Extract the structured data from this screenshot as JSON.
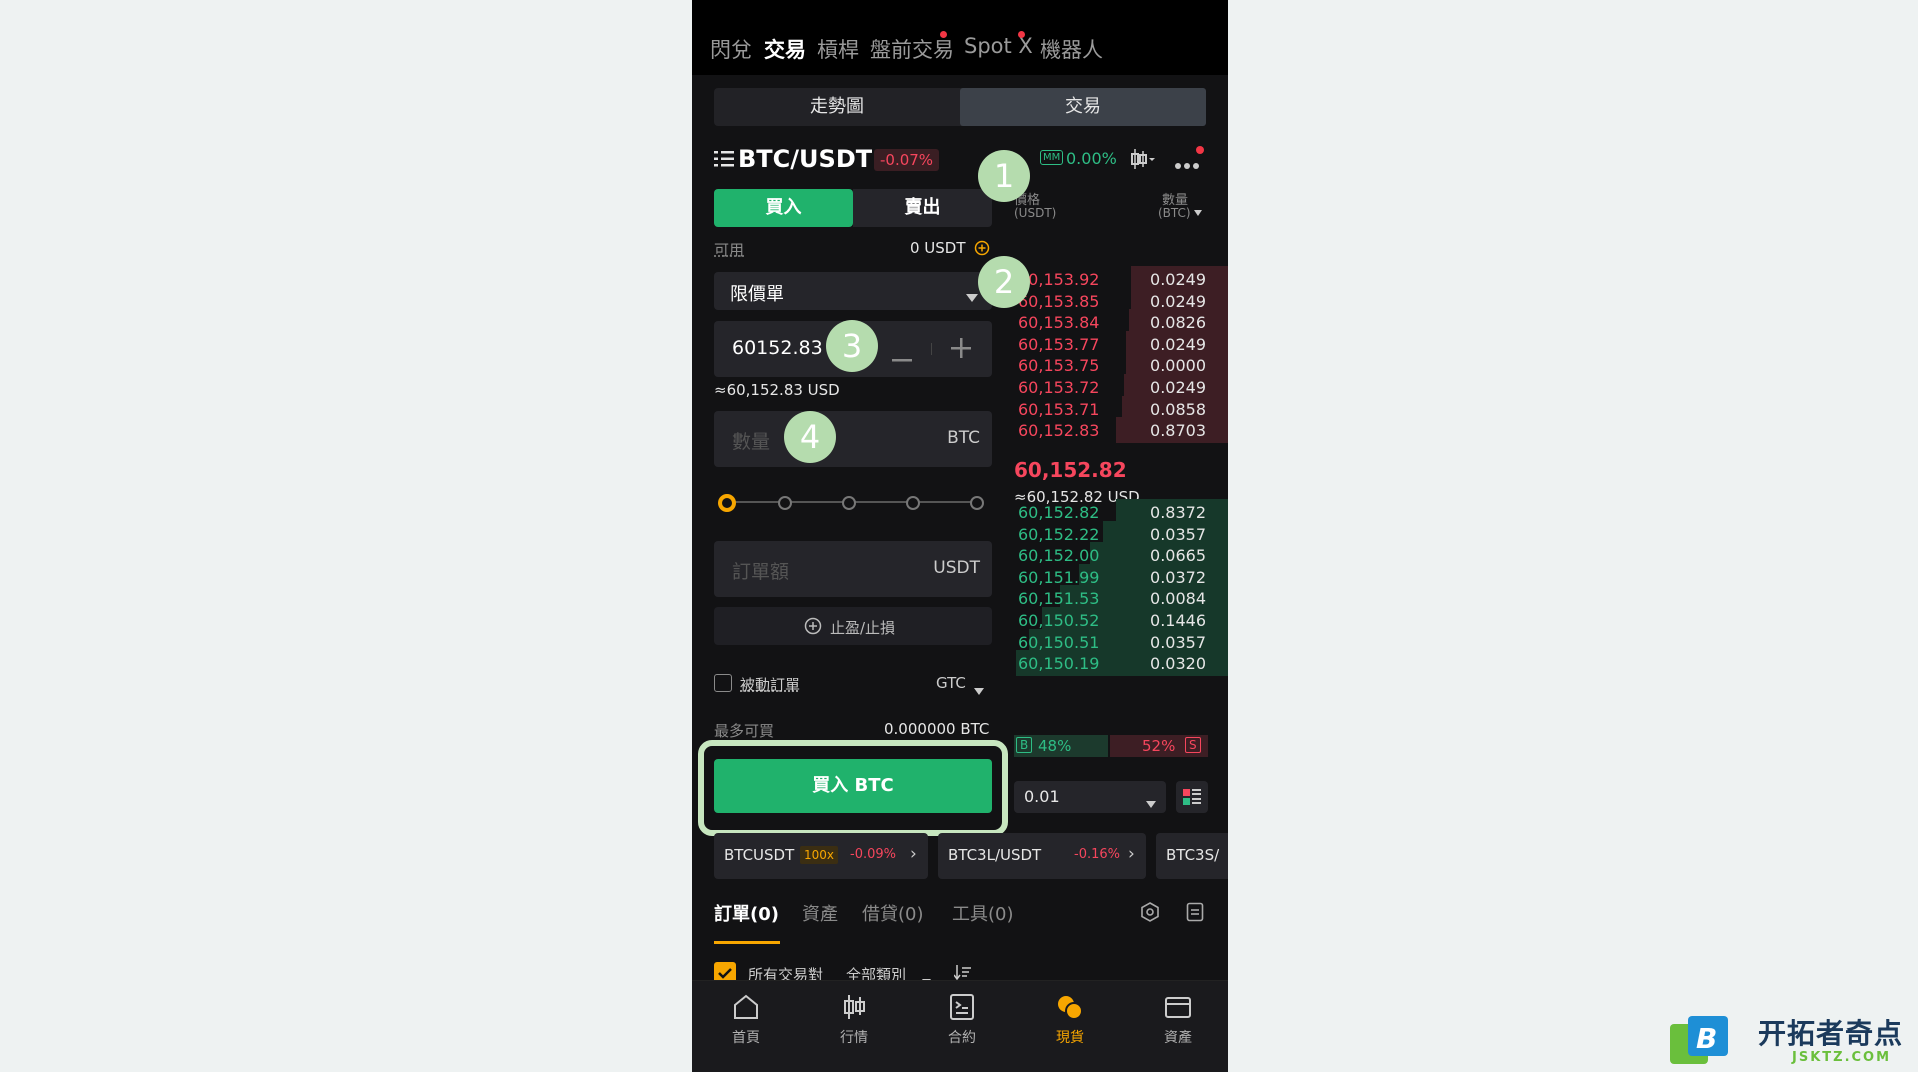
{
  "top_nav": {
    "tabs": [
      "閃兌",
      "交易",
      "槓桿",
      "盤前交易",
      "Spot X",
      "機器人"
    ],
    "active": "交易"
  },
  "segment": {
    "chart": "走勢圖",
    "trade": "交易"
  },
  "pair": {
    "symbol": "BTC/USDT",
    "change": "-0.07%",
    "mm_badge": "MM",
    "mm_value": "0.00%"
  },
  "order_form": {
    "buy_tab": "買入",
    "sell_tab": "賣出",
    "available_label": "可用",
    "available_value": "0 USDT",
    "order_type": "限價單",
    "price_value": "60152.83",
    "price_usd": "≈60,152.83 USD",
    "qty_placeholder": "數量",
    "qty_unit": "BTC",
    "slider_percent": 0,
    "amount_placeholder": "訂單額",
    "amount_unit": "USDT",
    "tpsl_label": "止盈/止損",
    "passive_label": "被動訂單",
    "tif": "GTC",
    "max_buy_label": "最多可買",
    "max_buy_value": "0.000000 BTC",
    "submit_label": "買入 BTC"
  },
  "orderbook": {
    "price_header": "價格",
    "price_unit": "(USDT)",
    "qty_header": "數量",
    "qty_unit": "(BTC)",
    "asks": [
      {
        "price": "60,153.92",
        "qty": "0.0249",
        "depth": 0.45
      },
      {
        "price": "60,153.85",
        "qty": "0.0249",
        "depth": 0.45
      },
      {
        "price": "60,153.84",
        "qty": "0.0826",
        "depth": 0.46
      },
      {
        "price": "60,153.77",
        "qty": "0.0249",
        "depth": 0.47
      },
      {
        "price": "60,153.75",
        "qty": "0.0000",
        "depth": 0.47
      },
      {
        "price": "60,153.72",
        "qty": "0.0249",
        "depth": 0.48
      },
      {
        "price": "60,153.71",
        "qty": "0.0858",
        "depth": 0.49
      },
      {
        "price": "60,152.83",
        "qty": "0.8703",
        "depth": 0.52
      }
    ],
    "mid_price": "60,152.82",
    "mid_usd": "≈60,152.82 USD",
    "bids": [
      {
        "price": "60,152.82",
        "qty": "0.8372",
        "depth": 0.52
      },
      {
        "price": "60,152.22",
        "qty": "0.0357",
        "depth": 0.58
      },
      {
        "price": "60,152.00",
        "qty": "0.0665",
        "depth": 0.64
      },
      {
        "price": "60,151.99",
        "qty": "0.0372",
        "depth": 0.69
      },
      {
        "price": "60,151.53",
        "qty": "0.0084",
        "depth": 0.78
      },
      {
        "price": "60,150.52",
        "qty": "0.1446",
        "depth": 0.86
      },
      {
        "price": "60,150.51",
        "qty": "0.0357",
        "depth": 0.92
      },
      {
        "price": "60,150.19",
        "qty": "0.0320",
        "depth": 0.98
      }
    ],
    "buy_badge": "B",
    "buy_pct": "48%",
    "sell_pct": "52%",
    "sell_badge": "S",
    "precision": "0.01"
  },
  "chips": [
    {
      "symbol": "BTCUSDT",
      "leverage": "100x",
      "change": "-0.09%"
    },
    {
      "symbol": "BTC3L/USDT",
      "leverage": "",
      "change": "-0.16%"
    },
    {
      "symbol": "BTC3S/",
      "leverage": "",
      "change": ""
    }
  ],
  "bottom_tabs": [
    "訂單(0)",
    "資產",
    "借貸(0)",
    "工具(0)"
  ],
  "filters": {
    "all_pairs": "所有交易對",
    "all_types": "全部類別"
  },
  "bottom_nav": [
    "首頁",
    "行情",
    "合約",
    "現貨",
    "資產"
  ],
  "bottom_nav_active": "現貨",
  "annotations": [
    "1",
    "2",
    "3",
    "4"
  ],
  "watermark": {
    "title": "开拓者奇点",
    "domain": "JSKTZ.COM",
    "logo_letter": "B"
  },
  "colors": {
    "buy_green": "#2ebd85",
    "sell_red": "#f6465d",
    "accent_orange": "#f7a600",
    "annotation": "#b5dcae"
  }
}
